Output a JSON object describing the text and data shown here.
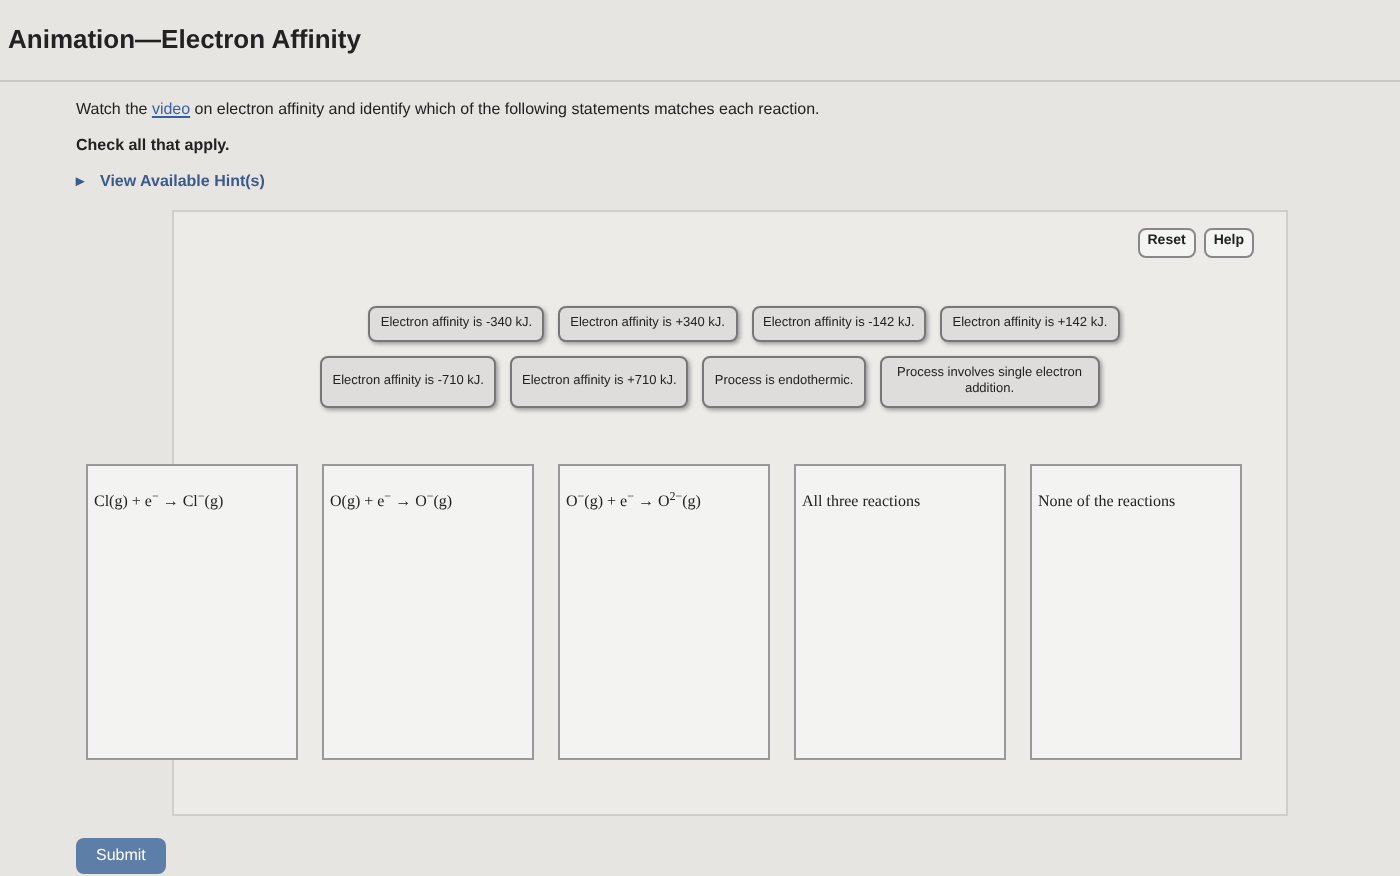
{
  "title": "Animation—Electron Affinity",
  "instructions": {
    "before": "Watch the ",
    "link": "video",
    "after": " on electron affinity and identify which of the following statements matches each reaction."
  },
  "note": "Check all that apply.",
  "hints": {
    "arrow": "▸",
    "label": "View Available Hint(s)",
    "expanded": false
  },
  "toolbar": [
    "Reset",
    "Help"
  ],
  "tile_rows": [
    [
      "Electron affinity is -340 kJ.",
      "Electron affinity is +340 kJ.",
      "Electron affinity is -142 kJ.",
      "Electron affinity is +142 kJ."
    ],
    [
      "Electron affinity is -710 kJ.",
      "Electron affinity is +710 kJ.",
      "Process is endothermic.",
      "Process involves single electron addition."
    ]
  ],
  "bins": [
    {
      "label": "Cl(g) + e$^{−}$ → Cl$^{−}$(g)"
    },
    {
      "label": "O(g) + e$^{−}$ → O$^{−}$(g)"
    },
    {
      "label": "O$^{−}$(g) + e$^{−}$ → O$^{2−}$(g)"
    },
    {
      "label": "All three reactions"
    },
    {
      "label": "None of the reactions"
    }
  ],
  "submit": "Submit"
}
